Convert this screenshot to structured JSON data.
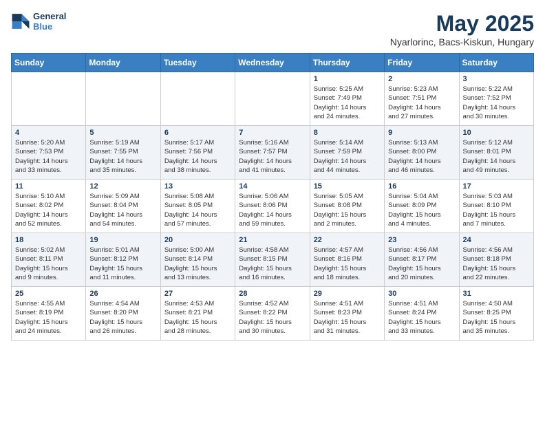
{
  "logo": {
    "line1": "General",
    "line2": "Blue"
  },
  "title": "May 2025",
  "subtitle": "Nyarlorinc, Bacs-Kiskun, Hungary",
  "days_header": [
    "Sunday",
    "Monday",
    "Tuesday",
    "Wednesday",
    "Thursday",
    "Friday",
    "Saturday"
  ],
  "weeks": [
    [
      {
        "day": "",
        "info": ""
      },
      {
        "day": "",
        "info": ""
      },
      {
        "day": "",
        "info": ""
      },
      {
        "day": "",
        "info": ""
      },
      {
        "day": "1",
        "info": "Sunrise: 5:25 AM\nSunset: 7:49 PM\nDaylight: 14 hours\nand 24 minutes."
      },
      {
        "day": "2",
        "info": "Sunrise: 5:23 AM\nSunset: 7:51 PM\nDaylight: 14 hours\nand 27 minutes."
      },
      {
        "day": "3",
        "info": "Sunrise: 5:22 AM\nSunset: 7:52 PM\nDaylight: 14 hours\nand 30 minutes."
      }
    ],
    [
      {
        "day": "4",
        "info": "Sunrise: 5:20 AM\nSunset: 7:53 PM\nDaylight: 14 hours\nand 33 minutes."
      },
      {
        "day": "5",
        "info": "Sunrise: 5:19 AM\nSunset: 7:55 PM\nDaylight: 14 hours\nand 35 minutes."
      },
      {
        "day": "6",
        "info": "Sunrise: 5:17 AM\nSunset: 7:56 PM\nDaylight: 14 hours\nand 38 minutes."
      },
      {
        "day": "7",
        "info": "Sunrise: 5:16 AM\nSunset: 7:57 PM\nDaylight: 14 hours\nand 41 minutes."
      },
      {
        "day": "8",
        "info": "Sunrise: 5:14 AM\nSunset: 7:59 PM\nDaylight: 14 hours\nand 44 minutes."
      },
      {
        "day": "9",
        "info": "Sunrise: 5:13 AM\nSunset: 8:00 PM\nDaylight: 14 hours\nand 46 minutes."
      },
      {
        "day": "10",
        "info": "Sunrise: 5:12 AM\nSunset: 8:01 PM\nDaylight: 14 hours\nand 49 minutes."
      }
    ],
    [
      {
        "day": "11",
        "info": "Sunrise: 5:10 AM\nSunset: 8:02 PM\nDaylight: 14 hours\nand 52 minutes."
      },
      {
        "day": "12",
        "info": "Sunrise: 5:09 AM\nSunset: 8:04 PM\nDaylight: 14 hours\nand 54 minutes."
      },
      {
        "day": "13",
        "info": "Sunrise: 5:08 AM\nSunset: 8:05 PM\nDaylight: 14 hours\nand 57 minutes."
      },
      {
        "day": "14",
        "info": "Sunrise: 5:06 AM\nSunset: 8:06 PM\nDaylight: 14 hours\nand 59 minutes."
      },
      {
        "day": "15",
        "info": "Sunrise: 5:05 AM\nSunset: 8:08 PM\nDaylight: 15 hours\nand 2 minutes."
      },
      {
        "day": "16",
        "info": "Sunrise: 5:04 AM\nSunset: 8:09 PM\nDaylight: 15 hours\nand 4 minutes."
      },
      {
        "day": "17",
        "info": "Sunrise: 5:03 AM\nSunset: 8:10 PM\nDaylight: 15 hours\nand 7 minutes."
      }
    ],
    [
      {
        "day": "18",
        "info": "Sunrise: 5:02 AM\nSunset: 8:11 PM\nDaylight: 15 hours\nand 9 minutes."
      },
      {
        "day": "19",
        "info": "Sunrise: 5:01 AM\nSunset: 8:12 PM\nDaylight: 15 hours\nand 11 minutes."
      },
      {
        "day": "20",
        "info": "Sunrise: 5:00 AM\nSunset: 8:14 PM\nDaylight: 15 hours\nand 13 minutes."
      },
      {
        "day": "21",
        "info": "Sunrise: 4:58 AM\nSunset: 8:15 PM\nDaylight: 15 hours\nand 16 minutes."
      },
      {
        "day": "22",
        "info": "Sunrise: 4:57 AM\nSunset: 8:16 PM\nDaylight: 15 hours\nand 18 minutes."
      },
      {
        "day": "23",
        "info": "Sunrise: 4:56 AM\nSunset: 8:17 PM\nDaylight: 15 hours\nand 20 minutes."
      },
      {
        "day": "24",
        "info": "Sunrise: 4:56 AM\nSunset: 8:18 PM\nDaylight: 15 hours\nand 22 minutes."
      }
    ],
    [
      {
        "day": "25",
        "info": "Sunrise: 4:55 AM\nSunset: 8:19 PM\nDaylight: 15 hours\nand 24 minutes."
      },
      {
        "day": "26",
        "info": "Sunrise: 4:54 AM\nSunset: 8:20 PM\nDaylight: 15 hours\nand 26 minutes."
      },
      {
        "day": "27",
        "info": "Sunrise: 4:53 AM\nSunset: 8:21 PM\nDaylight: 15 hours\nand 28 minutes."
      },
      {
        "day": "28",
        "info": "Sunrise: 4:52 AM\nSunset: 8:22 PM\nDaylight: 15 hours\nand 30 minutes."
      },
      {
        "day": "29",
        "info": "Sunrise: 4:51 AM\nSunset: 8:23 PM\nDaylight: 15 hours\nand 31 minutes."
      },
      {
        "day": "30",
        "info": "Sunrise: 4:51 AM\nSunset: 8:24 PM\nDaylight: 15 hours\nand 33 minutes."
      },
      {
        "day": "31",
        "info": "Sunrise: 4:50 AM\nSunset: 8:25 PM\nDaylight: 15 hours\nand 35 minutes."
      }
    ]
  ]
}
